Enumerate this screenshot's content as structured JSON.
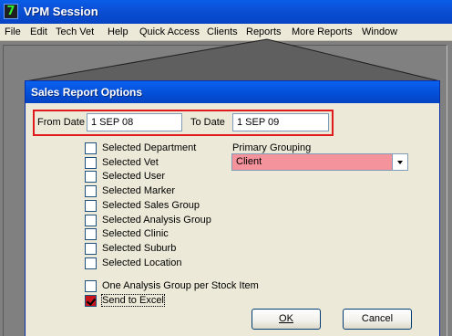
{
  "app": {
    "icon_glyph": "7",
    "title": "VPM Session"
  },
  "menubar": {
    "items": [
      "File",
      "Edit",
      "Tech Vet",
      "Help",
      "Quick Access",
      "Clients",
      "Reports",
      "More Reports",
      "Window"
    ]
  },
  "dialog": {
    "title": "Sales Report Options",
    "from_date_label": "From Date",
    "from_date_value": "1 SEP 08",
    "to_date_label": "To Date",
    "to_date_value": "1 SEP 09",
    "options": [
      {
        "label": "Selected Department",
        "checked": false
      },
      {
        "label": "Selected Vet",
        "checked": false
      },
      {
        "label": "Selected User",
        "checked": false
      },
      {
        "label": "Selected Marker",
        "checked": false
      },
      {
        "label": "Selected Sales Group",
        "checked": false
      },
      {
        "label": "Selected Analysis Group",
        "checked": false
      },
      {
        "label": "Selected Clinic",
        "checked": false
      },
      {
        "label": "Selected Suburb",
        "checked": false
      },
      {
        "label": "Selected Location",
        "checked": false
      }
    ],
    "one_analysis_label": "One Analysis Group per Stock Item",
    "one_analysis_checked": false,
    "send_to_excel_label": "Send to Excel",
    "send_to_excel_checked": true,
    "primary_grouping_label": "Primary Grouping",
    "primary_grouping_value": "Client",
    "ok_label": "OK",
    "cancel_label": "Cancel"
  },
  "colors": {
    "titlebar": "#0b50d6",
    "highlight_border": "#e0191d",
    "combo_bg": "#f5939c",
    "checked_box": "#c8141a"
  }
}
